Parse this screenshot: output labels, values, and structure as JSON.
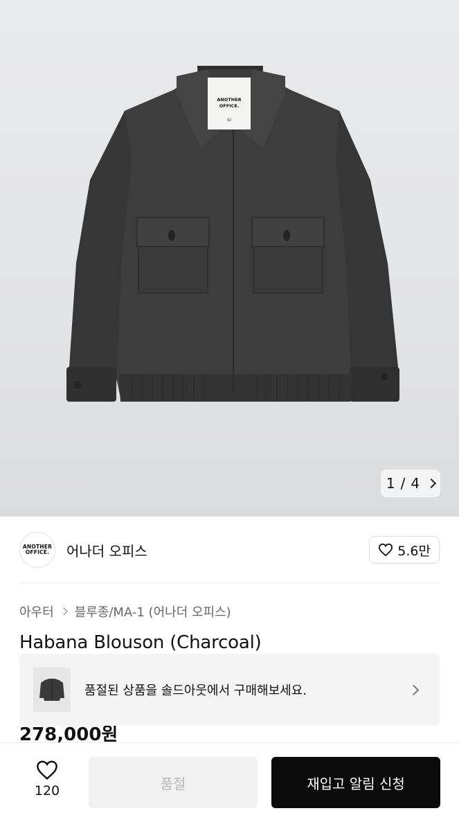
{
  "gallery": {
    "label_text": [
      "ANOTHER",
      "OFFICE.",
      "02"
    ],
    "counter_current": "1",
    "counter_sep": "/",
    "counter_total": "4"
  },
  "brand": {
    "logo_line1": "ANOTHER",
    "logo_line2": "OFFICE.",
    "name": "어나더 오피스",
    "likes": "5.6만"
  },
  "breadcrumb": {
    "level1": "아우터",
    "level2": "블루종/MA-1 (어나더 오피스)"
  },
  "product": {
    "title": "Habana Blouson (Charcoal)",
    "price": "278,000원"
  },
  "soldout_banner": {
    "text": "품절된 상품을 솔드아웃에서 구매해보세요."
  },
  "bottom_bar": {
    "like_count": "120",
    "soldout_label": "품절",
    "restock_label": "재입고 알림 신청"
  },
  "colors": {
    "jacket": "#3b3b3c",
    "primary_button": "#0b0b0b",
    "disabled_button": "#f1f1f2"
  }
}
